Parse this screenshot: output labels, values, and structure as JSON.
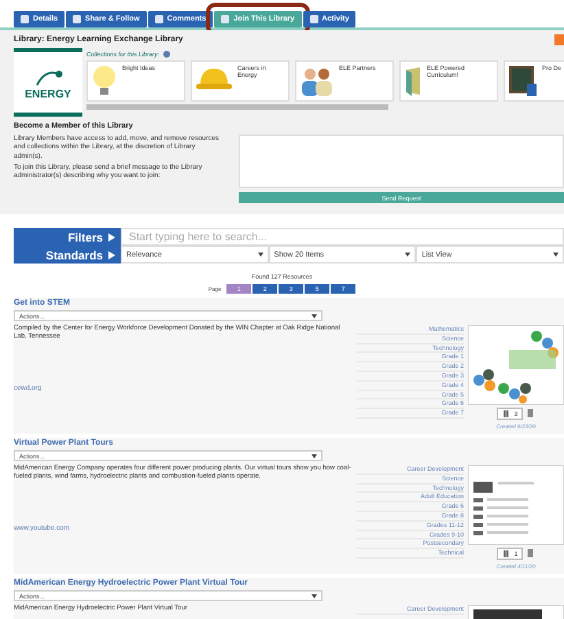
{
  "tabs": [
    {
      "label": "Details",
      "selected": false,
      "outlined": false
    },
    {
      "label": "Share & Follow",
      "selected": false,
      "outlined": false
    },
    {
      "label": "Comments",
      "selected": false,
      "outlined": false
    },
    {
      "label": "Join This Library",
      "selected": true,
      "outlined": true
    },
    {
      "label": "Activity",
      "selected": false,
      "outlined": false
    }
  ],
  "library": {
    "title": "Library: Energy Learning Exchange Library",
    "collections_label": "Collections for this Library:",
    "logo_text": "ENERGY",
    "collections": [
      {
        "label": "Bright Ideas",
        "kind": "bulb"
      },
      {
        "label": "Careers in Energy",
        "kind": "helmet"
      },
      {
        "label": "ELE Partners",
        "kind": "people"
      },
      {
        "label": "ELE Powered Curriculum!",
        "kind": "folder"
      },
      {
        "label": "Pro De",
        "kind": "board"
      }
    ]
  },
  "membership": {
    "heading": "Become a Member of this Library",
    "paragraphs": [
      "Library Members have access to add, move, and remove resources and collections within the Library, at the discretion of Library admin(s).",
      "To join this Library, please send a brief message to the Library administrator(s) describing why you want to join:"
    ],
    "button": "Send Request"
  },
  "search": {
    "filters": "Filters",
    "standards": "Standards",
    "placeholder": "Start typing here to search...",
    "dropdowns": [
      "Relevance",
      "Show 20 Items",
      "List View"
    ]
  },
  "results": {
    "found": "Found 127 Resources",
    "page_label": "Page",
    "pages": [
      {
        "label": "1",
        "selected": true
      },
      {
        "label": "2",
        "selected": false
      },
      {
        "label": "3",
        "selected": false
      },
      {
        "label": "5",
        "selected": false
      },
      {
        "label": "7",
        "selected": false
      }
    ]
  },
  "resources": [
    {
      "title": "Get into STEM",
      "actions": "Actions...",
      "description": "Compiled by the Center for Energy Workforce Development Donated by the WIN Chapter at Oak Ridge National Lab, Tennessee",
      "link": "cewd.org",
      "subjects": [
        "Mathematics",
        "Science",
        "Technology",
        "Grade 1",
        "Grade 2",
        "Grade 3",
        "Grade 4",
        "Grade 5",
        "Grade 6",
        "Grade 7"
      ],
      "thumbnail": {
        "kind": "logo"
      },
      "count": "3",
      "created": "Created 6/23/20"
    },
    {
      "title": "Virtual Power Plant Tours",
      "actions": "Actions...",
      "description": "MidAmerican Energy Company operates four different power producing plants. Our virtual tours show you how coal-fueled plants, wind farms, hydroelectric plants and combustion-fueled plants operate.",
      "link": "www.youtube.com",
      "subjects": [
        "Career Development",
        "Science",
        "Technology",
        "Adult Education",
        "Grade 6",
        "Grade 8",
        "Grades 11-12",
        "Grades 9-10",
        "Postsecondary",
        "Technical"
      ],
      "thumbnail": {
        "kind": "screenshot"
      },
      "count": "1",
      "created": "Created 4/11/20"
    },
    {
      "title": "MidAmerican Energy Hydroelectric Power Plant Virtual Tour",
      "actions": "Actions...",
      "description": "MidAmerican Energy Hydroelectric Power Plant Virtual Tour",
      "subjects": [
        "Career Development"
      ],
      "thumbnail": {
        "kind": "dark"
      }
    }
  ]
}
